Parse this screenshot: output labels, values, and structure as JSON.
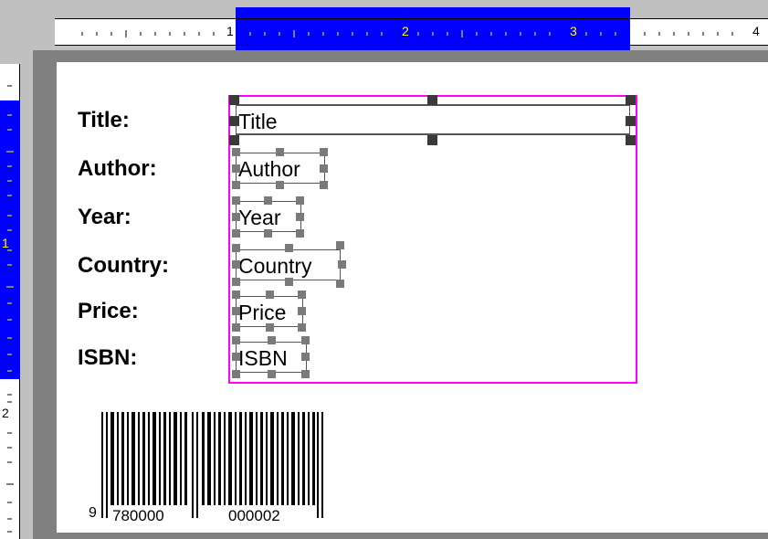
{
  "ruler": {
    "horizontal_numbers": [
      "1",
      "2",
      "3",
      "4"
    ],
    "vertical_numbers": [
      "1",
      "2"
    ]
  },
  "labels": [
    {
      "text": "Title:"
    },
    {
      "text": "Author:"
    },
    {
      "text": "Year:"
    },
    {
      "text": "Country:"
    },
    {
      "text": "Price:"
    },
    {
      "text": "ISBN:"
    }
  ],
  "fields": [
    {
      "text": "Title"
    },
    {
      "text": "Author"
    },
    {
      "text": "Year"
    },
    {
      "text": "Country"
    },
    {
      "text": "Price"
    },
    {
      "text": "ISBN"
    }
  ],
  "barcode": {
    "digit_first": "9",
    "digits_left": "780000",
    "digits_right": "000002"
  },
  "colors": {
    "selection_blue": "#0000ff",
    "group_border": "#ff00ff",
    "handle_gray": "#7a7a7a"
  }
}
